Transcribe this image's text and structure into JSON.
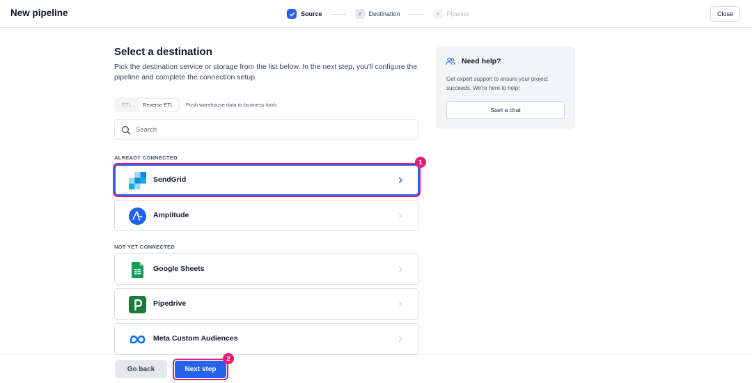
{
  "header": {
    "title": "New pipeline",
    "close_label": "Close",
    "steps": [
      {
        "number": "",
        "label": "Source",
        "state": "done"
      },
      {
        "number": "2",
        "label": "Destination",
        "state": "current"
      },
      {
        "number": "3",
        "label": "Pipeline",
        "state": "future"
      }
    ]
  },
  "main": {
    "title": "Select a destination",
    "description": "Pick the destination service or storage from the list below. In the next step, you'll configure the pipeline and complete the connection setup.",
    "mode_toggle": {
      "options": [
        "ETL",
        "Reverse ETL"
      ],
      "selected": "Reverse ETL",
      "hint": "Push warehouse data to business tools"
    },
    "search": {
      "placeholder": "Search",
      "value": ""
    },
    "connected_label": "ALREADY CONNECTED",
    "connected": [
      {
        "name": "SendGrid",
        "icon": "sendgrid-logo",
        "selected": true
      },
      {
        "name": "Amplitude",
        "icon": "amplitude-logo",
        "selected": false
      }
    ],
    "not_connected_label": "NOT YET CONNECTED",
    "not_connected": [
      {
        "name": "Google Sheets",
        "icon": "google-sheets-logo"
      },
      {
        "name": "Pipedrive",
        "icon": "pipedrive-logo"
      },
      {
        "name": "Meta Custom Audiences",
        "icon": "meta-logo"
      }
    ]
  },
  "help": {
    "title": "Need help?",
    "text": "Get expert support to ensure your project succeeds. We're here to help!",
    "button_label": "Start a chat",
    "icon": "people-icon"
  },
  "footer": {
    "back_label": "Go back",
    "next_label": "Next step"
  },
  "annotations": [
    "1",
    "2"
  ],
  "colors": {
    "accent": "#2563eb",
    "highlight": "#e11d74",
    "sendgrid": "#1a82e2",
    "amplitude": "#1e61f0",
    "sheets": "#0f9d58",
    "pipedrive": "#1a7b3a",
    "meta": "#0866ff"
  }
}
